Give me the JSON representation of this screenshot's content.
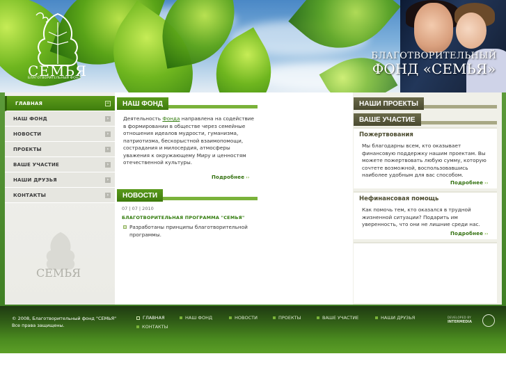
{
  "header": {
    "logo_text": "СЕМЬЯ",
    "logo_sub": "БЛАГОТВОРИТЕЛЬНЫЙ ФОНД",
    "fund_line1": "БЛАГОТВОРИТЕЛЬНЫЙ",
    "fund_line2": "ФОНД «СЕМЬЯ»"
  },
  "menu": {
    "items": [
      {
        "label": "ГЛАВНАЯ",
        "active": true
      },
      {
        "label": "НАШ ФОНД",
        "active": false
      },
      {
        "label": "НОВОСТИ",
        "active": false
      },
      {
        "label": "ПРОЕКТЫ",
        "active": false
      },
      {
        "label": "ВАШЕ УЧАСТИЕ",
        "active": false
      },
      {
        "label": "НАШИ ДРУЗЬЯ",
        "active": false
      },
      {
        "label": "КОНТАКТЫ",
        "active": false
      }
    ],
    "ghost_logo_text": "СЕМЬЯ"
  },
  "fond": {
    "heading": "НАШ ФОНД",
    "text_before": "Деятельность ",
    "link": "Фонда",
    "text_after": " направлена на содействие в формировании в обществе через семейные отношения идеалов мудрости, гуманизма, патриотизма, бескорыстной взаимопомощи, сострадания и милосердия, атмосферы уважения к окружающему Миру и ценностям отечественной культуры.",
    "more": "Подробнее"
  },
  "news": {
    "heading": "НОВОСТИ",
    "date": "07 | 07 | 2010",
    "title": "БЛАГОТВОРИТЕЛЬНАЯ ПРОГРАММА \"СЕМЬЯ\"",
    "item": "Разработаны принципы благотворительной программы."
  },
  "right": {
    "projects_heading": "НАШИ ПРОЕКТЫ",
    "participation_heading": "ВАШЕ УЧАСТИЕ",
    "donations_title": "Пожертвования",
    "donations_text": "Мы благодарны всем, кто оказывает финансовую поддержку нашим проектам. Вы можете пожертвовать любую сумму, которую сочтете возможной, воспользовавшись наиболее удобным для вас способом.",
    "donations_more": "Подробнее",
    "nonfin_title": "Нефинансовая помощь",
    "nonfin_text": "Как помочь тем, кто оказался в трудной жизненной ситуации? Подарить им уверенность, что они не лишние среди нас.",
    "nonfin_more": "Подробнее"
  },
  "footer": {
    "copy1": "© 2008, Благотворительный фонд \"СЕМЬЯ\"",
    "copy2": "Все права защищены.",
    "links": [
      "ГЛАВНАЯ",
      "НАШ ФОНД",
      "НОВОСТИ",
      "ПРОЕКТЫ",
      "ВАШЕ УЧАСТИЕ",
      "НАШИ ДРУЗЬЯ",
      "КОНТАКТЫ"
    ],
    "dev_line1": "DEVELOPED BY",
    "dev_line2": "INTERMEDIA"
  },
  "colors": {
    "accent_green": "#3e7a0d",
    "olive": "#4a4a30",
    "link_green": "#2f7a0a"
  }
}
